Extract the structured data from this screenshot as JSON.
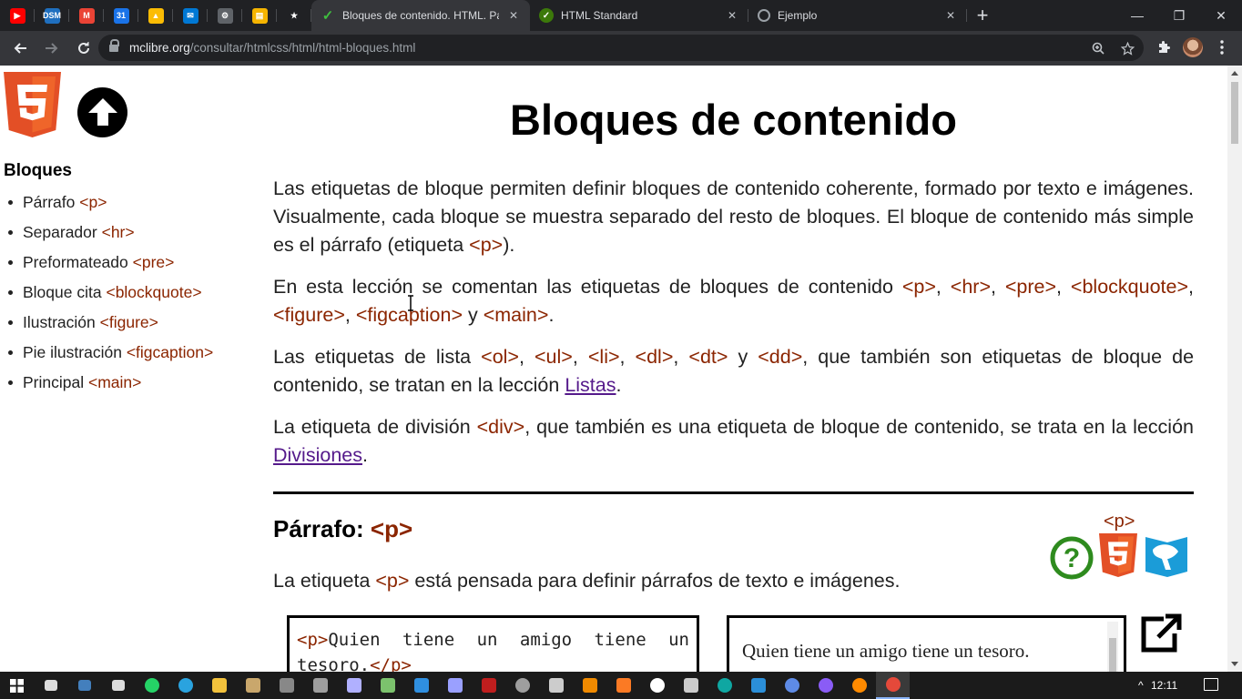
{
  "browser": {
    "pinned_tabs": [
      {
        "icon": "youtube-icon",
        "color": "#ff0000",
        "glyph": "▶"
      },
      {
        "icon": "dsm-icon",
        "color": "#1f6fbf",
        "glyph": "DSM"
      },
      {
        "icon": "gmail-icon",
        "color": "#ea4335",
        "glyph": "M"
      },
      {
        "icon": "calendar-icon",
        "color": "#1a73e8",
        "glyph": "31"
      },
      {
        "icon": "drive-icon",
        "color": "#fbbc04",
        "glyph": "▲"
      },
      {
        "icon": "mail-icon",
        "color": "#0078d4",
        "glyph": "✉"
      },
      {
        "icon": "sync-icon",
        "color": "#5f6368",
        "glyph": "⚙"
      },
      {
        "icon": "notes-icon",
        "color": "#f5b400",
        "glyph": "▤"
      },
      {
        "icon": "star-icon",
        "color": "#202124",
        "glyph": "★"
      }
    ],
    "tabs": [
      {
        "title": "Bloques de contenido. HTML. Pá",
        "icon": "mclibre-icon",
        "active": true
      },
      {
        "title": "HTML Standard",
        "icon": "whatwg-icon",
        "active": false
      },
      {
        "title": "Ejemplo",
        "icon": "globe-icon",
        "active": false
      }
    ],
    "url_host": "mclibre.org",
    "url_path": "/consultar/htmlcss/html/html-bloques.html"
  },
  "sidebar": {
    "title": "Bloques",
    "items": [
      {
        "label": "Párrafo",
        "tag": "<p>"
      },
      {
        "label": "Separador",
        "tag": "<hr>"
      },
      {
        "label": "Preformateado",
        "tag": "<pre>"
      },
      {
        "label": "Bloque cita",
        "tag": "<blockquote>"
      },
      {
        "label": "Ilustración",
        "tag": "<figure>"
      },
      {
        "label": "Pie ilustración",
        "tag": "<figcaption>"
      },
      {
        "label": "Principal",
        "tag": "<main>"
      }
    ]
  },
  "main": {
    "title": "Bloques de contenido",
    "p1": {
      "a": "Las etiquetas de bloque permiten definir bloques de contenido coherente, formado por texto e imágenes. Visualmente, cada bloque se muestra separado del resto de bloques. El bloque de contenido más simple es el párrafo (etiqueta ",
      "tag": "<p>",
      "b": ")."
    },
    "p2": {
      "a": "En esta lección se comentan las etiquetas de bloques de contenido ",
      "t1": "<p>",
      "s1": ", ",
      "t2": "<hr>",
      "s2": ", ",
      "t3": "<pre>",
      "s3": ", ",
      "t4": "<blockquote>",
      "s4": ", ",
      "t5": "<figure>",
      "s5": ", ",
      "t6": "<figcaption>",
      "s6": " y ",
      "t7": "<main>",
      "s7": "."
    },
    "p3": {
      "a": "Las etiquetas de lista ",
      "t1": "<ol>",
      "s1": ", ",
      "t2": "<ul>",
      "s2": ", ",
      "t3": "<li>",
      "s3": ", ",
      "t4": "<dl>",
      "s4": ", ",
      "t5": "<dt>",
      "s5": " y ",
      "t6": "<dd>",
      "b": ", que también son etiquetas de bloque de contenido, se tratan en la lección ",
      "link": "Listas",
      "c": "."
    },
    "p4": {
      "a": "La etiqueta de división ",
      "tag": "<div>",
      "b": ", que también es una etiqueta de bloque de contenido, se trata en la lección ",
      "link": "Divisiones",
      "c": "."
    },
    "section": {
      "title": "Párrafo: ",
      "tag": "<p>",
      "icons_tag": "<p>",
      "desc_a": "La etiqueta ",
      "desc_tag": "<p>",
      "desc_b": " está pensada para definir párrafos de texto e imágenes.",
      "code_open": "<p>",
      "code_text1": "Quien tiene un amigo tiene un",
      "code_text2": "tesoro.",
      "code_close": "</p>",
      "result": "Quien tiene un amigo tiene un tesoro."
    }
  },
  "taskbar": {
    "apps": [
      {
        "icon": "task-view-icon",
        "color": "#ffffff"
      },
      {
        "icon": "keyboard-icon",
        "color": "#4a90d9"
      },
      {
        "icon": "settings-app-icon",
        "color": "#ffffff"
      },
      {
        "icon": "whatsapp-icon",
        "color": "#25d366"
      },
      {
        "icon": "telegram-icon",
        "color": "#2aa3df"
      },
      {
        "icon": "explorer-icon",
        "color": "#f3c23c"
      },
      {
        "icon": "books-icon",
        "color": "#c9a76c"
      },
      {
        "icon": "terminal-icon",
        "color": "#888888"
      },
      {
        "icon": "photo-icon",
        "color": "#9e9e9e"
      },
      {
        "icon": "notepad-icon",
        "color": "#b0b0ff"
      },
      {
        "icon": "editor-icon",
        "color": "#7cc26d"
      },
      {
        "icon": "vscode-icon",
        "color": "#2f8fe0"
      },
      {
        "icon": "app-icon",
        "color": "#9aa0ff"
      },
      {
        "icon": "filezilla-icon",
        "color": "#bf1e1e"
      },
      {
        "icon": "chrome-dev-icon",
        "color": "#9e9e9e"
      },
      {
        "icon": "box-icon",
        "color": "#cccccc"
      },
      {
        "icon": "vlc-icon",
        "color": "#f08a00"
      },
      {
        "icon": "xampp-icon",
        "color": "#fb7a24"
      },
      {
        "icon": "media-icon",
        "color": "#ffffff"
      },
      {
        "icon": "remote-icon",
        "color": "#cccccc"
      },
      {
        "icon": "edge-icon",
        "color": "#0fa7a2"
      },
      {
        "icon": "ie-icon",
        "color": "#2b8fd9"
      },
      {
        "icon": "chromium-icon",
        "color": "#5e8be6"
      },
      {
        "icon": "vpn-icon",
        "color": "#8a5cf6"
      },
      {
        "icon": "firefox-icon",
        "color": "#ff8a00"
      },
      {
        "icon": "chrome-icon",
        "color": "#e5493a"
      }
    ],
    "time": "12:11"
  }
}
